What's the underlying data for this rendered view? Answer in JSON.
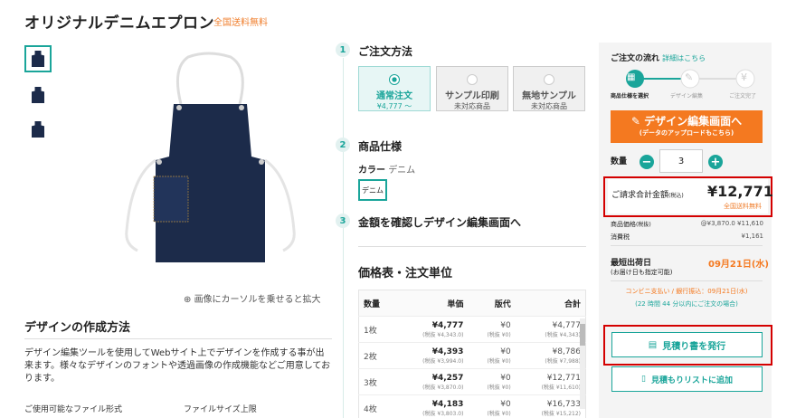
{
  "product": {
    "title": "オリジナルデニムエプロン",
    "shipping_badge": "全国送料無料"
  },
  "gallery": {
    "zoom_hint": "画像にカーソルを乗せると拡大"
  },
  "design_method": {
    "heading": "デザインの作成方法",
    "text": "デザイン編集ツールを使用してWebサイト上でデザインを作成する事が出来ます。様々なデザインのフォントや透過画像の作成機能などご用意しております。",
    "file_format_label": "ご使用可能なファイル形式",
    "file_size_label": "ファイルサイズ上限"
  },
  "steps": [
    {
      "num": "1",
      "title": "ご注文方法"
    },
    {
      "num": "2",
      "title": "商品仕様"
    },
    {
      "num": "3",
      "title": "金額を確認しデザイン編集画面へ"
    }
  ],
  "order_options": [
    {
      "label": "通常注文",
      "sub": "¥4,777 〜"
    },
    {
      "label": "サンプル印刷",
      "sub": "未対応商品"
    },
    {
      "label": "無地サンプル",
      "sub": "未対応商品"
    }
  ],
  "spec": {
    "color_label": "カラー",
    "color_value": "デニム",
    "swatch_label": "デニム"
  },
  "price_table": {
    "heading": "価格表・注文単位",
    "headers": [
      "数量",
      "単価",
      "版代",
      "合計"
    ],
    "rows": [
      {
        "qty": "1枚",
        "unit": "¥4,777",
        "unit_sub": "(税抜 ¥4,343.0)",
        "plate": "¥0",
        "plate_sub": "(税抜 ¥0)",
        "total": "¥4,777",
        "total_sub": "(税抜 ¥4,343)"
      },
      {
        "qty": "2枚",
        "unit": "¥4,393",
        "unit_sub": "(税抜 ¥3,994.0)",
        "plate": "¥0",
        "plate_sub": "(税抜 ¥0)",
        "total": "¥8,786",
        "total_sub": "(税抜 ¥7,988)"
      },
      {
        "qty": "3枚",
        "unit": "¥4,257",
        "unit_sub": "(税抜 ¥3,870.0)",
        "plate": "¥0",
        "plate_sub": "(税抜 ¥0)",
        "total": "¥12,771",
        "total_sub": "(税抜 ¥11,610)"
      },
      {
        "qty": "4枚",
        "unit": "¥4,183",
        "unit_sub": "(税抜 ¥3,803.0)",
        "plate": "¥0",
        "plate_sub": "(税抜 ¥0)",
        "total": "¥16,733",
        "total_sub": "(税抜 ¥15,212)"
      }
    ]
  },
  "order_panel": {
    "flow_label": "ご注文の流れ",
    "flow_link": "詳細はこちら",
    "flow_steps": [
      "商品仕様を選択",
      "デザイン編集",
      "ご注文完了"
    ],
    "design_button": "デザイン編集画面へ",
    "design_button_sub": "(データのアップロードもこちら)",
    "qty_label": "数量",
    "qty_value": "3",
    "total_label": "ご請求合計金額",
    "total_tax": "(税込)",
    "total_value": "¥12,771",
    "total_shipping": "全国送料無料",
    "item_price_label": "商品価格",
    "item_price_tax": "(税抜)",
    "item_price_value": "@¥3,870.0 ¥11,610",
    "tax_label": "消費税",
    "tax_value": "¥1,161",
    "ship_label": "最短出荷日",
    "ship_sub": "(お届け日も指定可能)",
    "ship_date": "09月21日(水)",
    "payment_note": "コンビニ支払い / 銀行振込：09月21日(水)",
    "payment_note2": "(22 時間 44 分以内にご注文の場合)",
    "quote_button": "見積り書を発行",
    "wishlist_button": "見積もりリストに追加"
  },
  "colors": {
    "accent": "#1aa59a",
    "orange": "#f47920",
    "highlight": "#d40000",
    "denim": "#1c2b4a"
  }
}
